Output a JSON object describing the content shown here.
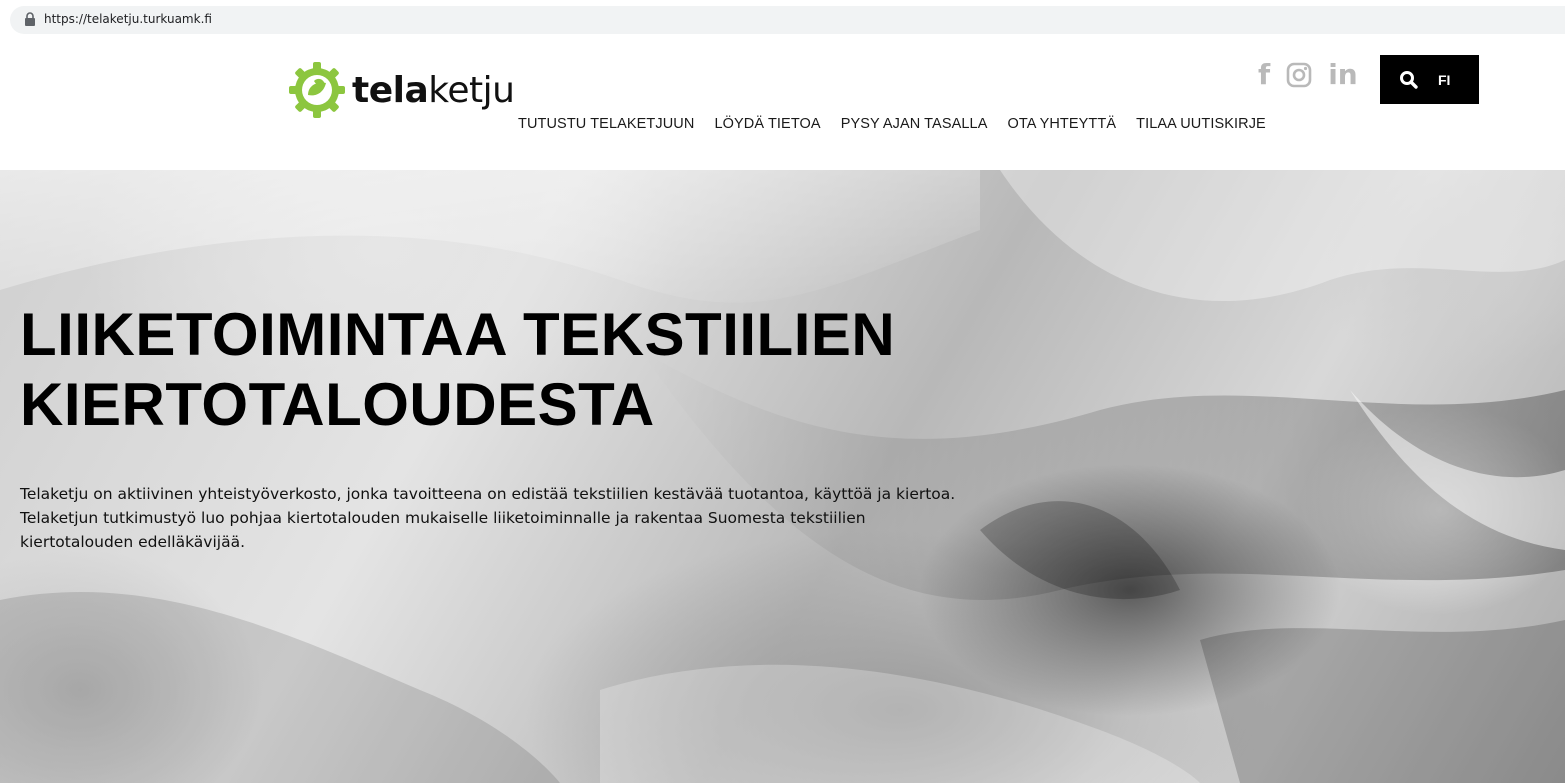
{
  "browser": {
    "url": "https://telaketju.turkuamk.fi",
    "icons": {
      "lock": "lock-icon"
    }
  },
  "header": {
    "logo": {
      "bold": "tela",
      "light": "ketju",
      "icon": "gear-leaf-logo-icon",
      "color": "#8cc63f"
    },
    "nav": [
      {
        "label": "TUTUSTU TELAKETJUUN"
      },
      {
        "label": "LÖYDÄ TIETOA"
      },
      {
        "label": "PYSY AJAN TASALLA"
      },
      {
        "label": "OTA YHTEYTTÄ"
      },
      {
        "label": "TILAA UUTISKIRJE"
      }
    ],
    "social": {
      "facebook": "f",
      "instagram": "instagram-icon",
      "linkedin": "in",
      "color": "#b9b9b9"
    },
    "tools": {
      "search_icon": "search-icon",
      "language": "FI"
    }
  },
  "hero": {
    "title_line1": "LIIKETOIMINTAA TEKSTIILIEN",
    "title_line2": "KIERTOTALOUDESTA",
    "description": "Telaketju on aktiivinen yhteistyöverkosto, jonka tavoitteena on edistää tekstiilien kestävää tuotantoa, käyttöä ja kiertoa. Telaketjun tutkimustyö luo pohjaa kiertotalouden mukaiselle liiketoiminnalle ja rakentaa Suomesta tekstiilien kiertotalouden edelläkävijää."
  }
}
